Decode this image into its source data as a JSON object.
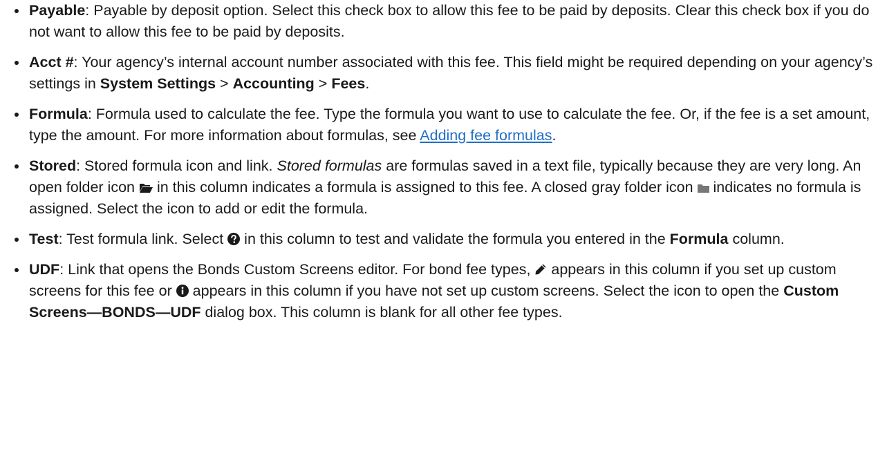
{
  "items": [
    {
      "term": "Payable",
      "text": ": Payable by deposit option. Select this check box to allow this fee to be paid by deposits. Clear this check box if you do not want to allow this fee to be paid by deposits."
    },
    {
      "term": "Acct #",
      "text1": ": Your agency’s internal account number associated with this fee. This field might be required depending on your agency’s settings in ",
      "path1": "System Settings",
      "sep1": " > ",
      "path2": "Accounting",
      "sep2": " > ",
      "path3": "Fees",
      "end": "."
    },
    {
      "term": "Formula",
      "text1": ": Formula used to calculate the fee. Type the formula you want to use to calculate the fee. Or, if the fee is a set amount, type the amount. For more information about formulas, see ",
      "link": "Adding fee formulas",
      "end": "."
    },
    {
      "term": "Stored",
      "text1": ": Stored formula icon and link. ",
      "italic": "Stored formulas",
      "text2": " are formulas saved in a text file, typically because they are very long. An open folder icon ",
      "open_folder_icon": "folder-open-icon",
      "text3": " in this column indicates a formula is assigned to this fee. A closed gray folder icon ",
      "closed_folder_icon": "folder-closed-icon",
      "text4": " indicates no formula is assigned. Select the icon to add or edit the formula."
    },
    {
      "term": "Test",
      "text1": ": Test formula link. Select ",
      "help_icon": "question-circle-icon",
      "text2": " in this column to test and validate the formula you entered in the ",
      "bold2": "Formula",
      "text3": " column."
    },
    {
      "term": "UDF",
      "text1": ": Link that opens the Bonds Custom Screens editor. For bond fee types, ",
      "pencil_icon": "pencil-icon",
      "text2": " appears in this column if you set up custom screens for this fee or ",
      "info_icon": "info-circle-icon",
      "text3": " appears in this column if you have not set up custom screens. Select the icon to open the ",
      "bold2": "Custom Screens—BONDS—UDF",
      "text4": " dialog box. This column is blank for all other fee types."
    }
  ],
  "colors": {
    "text": "#1a1a1a",
    "link": "#1f6fc5",
    "closed_folder": "#777777"
  }
}
